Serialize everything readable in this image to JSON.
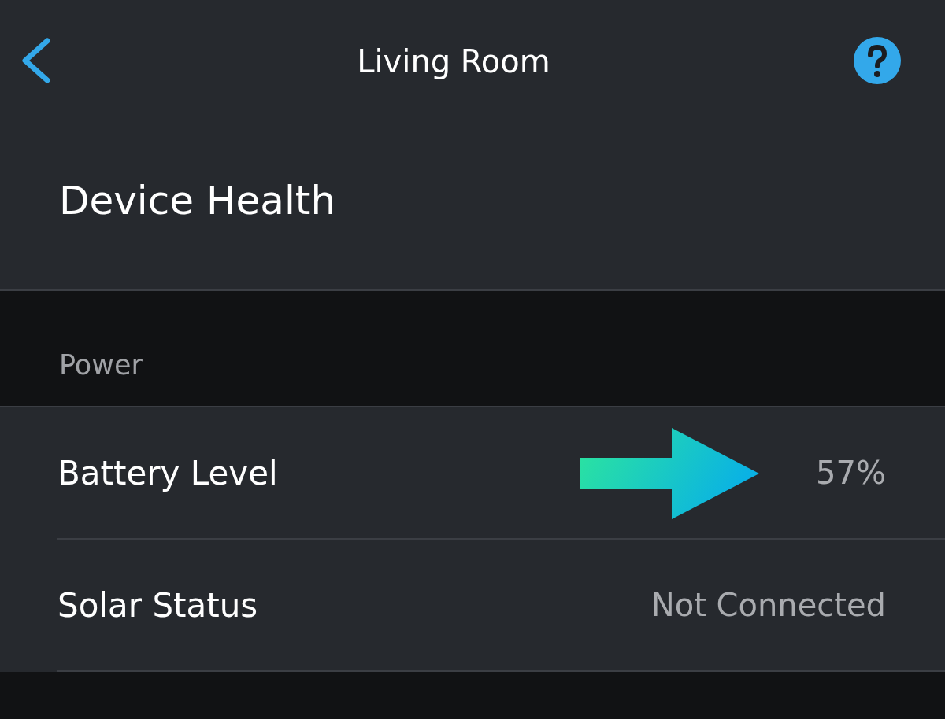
{
  "header": {
    "title": "Living Room"
  },
  "page_title": "Device Health",
  "sections": [
    {
      "heading": "Power",
      "rows": [
        {
          "label": "Battery Level",
          "value": "57%",
          "highlighted": true
        },
        {
          "label": "Solar Status",
          "value": "Not Connected",
          "highlighted": false
        }
      ]
    }
  ]
}
